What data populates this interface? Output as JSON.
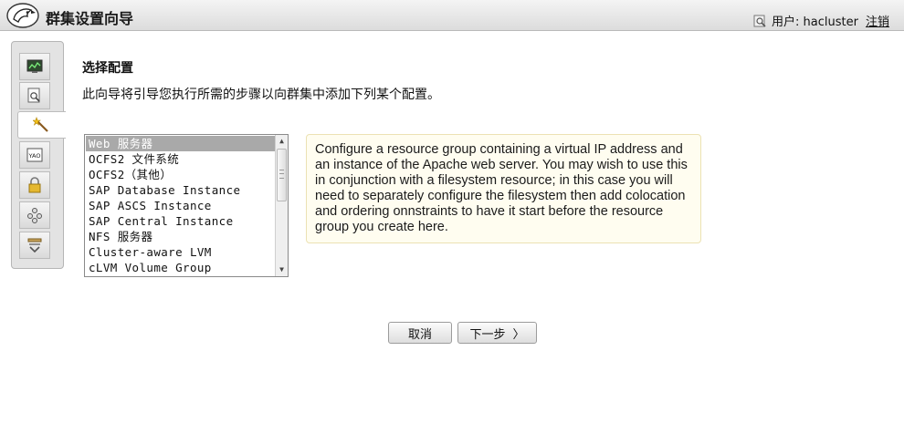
{
  "header": {
    "title": "群集设置向导",
    "user_prefix": "用户: hacluster",
    "logout_label": "注销"
  },
  "steps": [
    {
      "icon": "monitor-icon"
    },
    {
      "icon": "document-search-icon"
    },
    {
      "icon": "wand-icon",
      "active": true
    },
    {
      "icon": "yao-icon"
    },
    {
      "icon": "lock-icon"
    },
    {
      "icon": "resources-icon"
    },
    {
      "icon": "summary-icon"
    }
  ],
  "main": {
    "title": "选择配置",
    "description": "此向导将引导您执行所需的步骤以向群集中添加下列某个配置。",
    "options": [
      "Web 服务器",
      "OCFS2 文件系统",
      "OCFS2（其他）",
      "SAP Database Instance",
      "SAP ASCS Instance",
      "SAP Central Instance",
      "NFS 服务器",
      "Cluster-aware LVM",
      "cLVM Volume Group"
    ],
    "selected_index": 0,
    "info": "Configure a resource group containing a virtual IP address and an instance of the Apache web server. You may wish to use this in conjunction with a filesystem resource; in this case you will need to separately configure the filesystem then add colocation and ordering onnstraints to have it start before the resource group you create here."
  },
  "buttons": {
    "cancel": "取消",
    "next": "下一步",
    "next_arrow": "〉"
  },
  "colors": {
    "selection": "#a9a9a9",
    "info_bg": "#fffdf0",
    "info_border": "#ece2b3"
  }
}
